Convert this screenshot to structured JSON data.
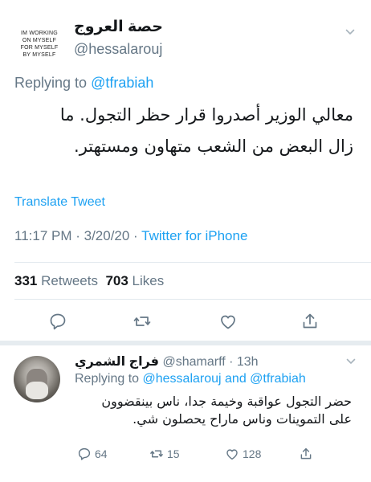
{
  "main_tweet": {
    "avatar_text": [
      "IM WORKING",
      "ON MYSELF",
      "FOR MYSELF",
      "BY MYSELF"
    ],
    "display_name": "حصة العروج",
    "handle": "@hessalarouj",
    "replying_prefix": "Replying to",
    "replying_handle": "@tfrabiah",
    "text_line1": "معالي الوزير أصدروا قرار حظر التجول. ما",
    "text_line2": "زال البعض من الشعب متهاون ومستهتر.",
    "translate_label": "Translate Tweet",
    "timestamp": "11:17 PM · 3/20/20 · ",
    "source": "Twitter for iPhone",
    "retweets_count": "331",
    "retweets_label": "Retweets",
    "likes_count": "703",
    "likes_label": "Likes"
  },
  "reply_tweet": {
    "display_name": "فراج الشمري",
    "handle_time": "@shamarff · 13h",
    "replying_prefix": "Replying to",
    "replying_handles": "@hessalarouj and @tfrabiah",
    "text_line1": "حضر التجول عواقبة وخيمة جدا، ناس بينقضوون",
    "text_line2": "على التموينات وناس ماراح يحصلون شي.",
    "reply_count": "64",
    "retweet_count": "15",
    "like_count": "128"
  },
  "colors": {
    "link": "#1da1f2",
    "secondary_text": "#657786",
    "primary_text": "#14171a",
    "divider": "#e1e8ed"
  },
  "icons": [
    "chevron-down-icon",
    "reply-icon",
    "retweet-icon",
    "like-icon",
    "share-icon"
  ]
}
